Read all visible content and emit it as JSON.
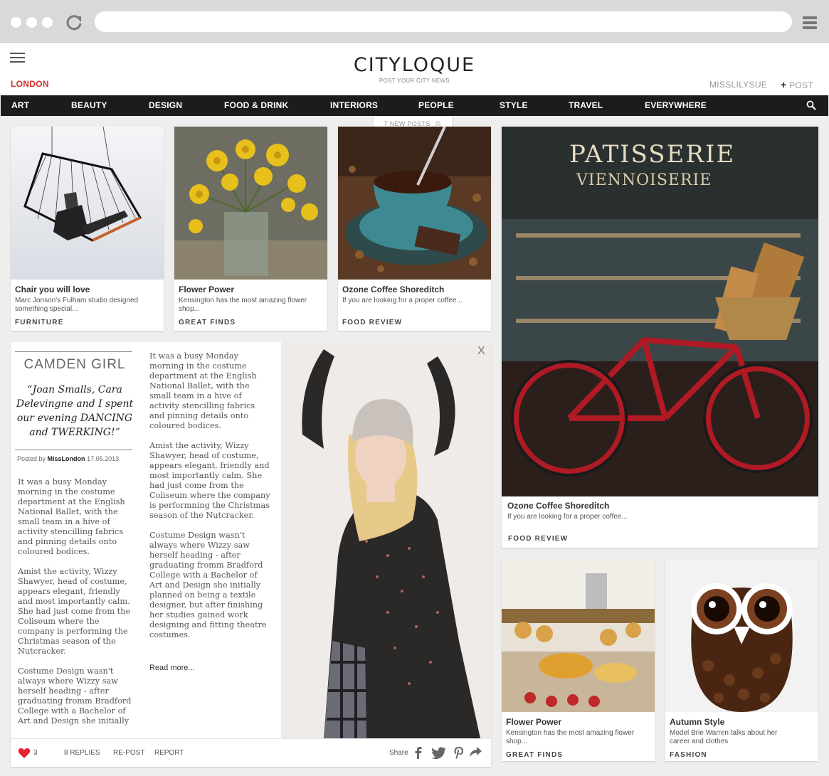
{
  "site": {
    "logo": "CITYLOQUE",
    "tagline": "POST YOUR CITY NEWS",
    "city": "LONDON",
    "user": "MISSLILYSUE",
    "post_label": "POST",
    "post_plus": "+"
  },
  "nav": {
    "items": [
      "ART",
      "BEAUTY",
      "DESIGN",
      "FOOD & DRINK",
      "INTERIORS",
      "PEOPLE",
      "STYLE",
      "TRAVEL",
      "EVERYWHERE"
    ],
    "new_posts": "7 NEW POSTS"
  },
  "cards": [
    {
      "title": "Chair you will love",
      "desc": "Marc Jonson's Fulham studio designed something special...",
      "category": "FURNITURE"
    },
    {
      "title": "Flower Power",
      "desc": "Kensington has the most amazing flower shop...",
      "category": "GREAT FINDS"
    },
    {
      "title": "Ozone Coffee Shoreditch",
      "desc": "If you are looking for a proper coffee...",
      "category": "FOOD REVIEW"
    },
    {
      "title": "Ozone Coffee Shoreditch",
      "desc": "If you are looking for a proper coffee...",
      "category": "FOOD REVIEW",
      "sign": "PATISSERIE",
      "sign2": "VIENNOISERIE"
    },
    {
      "title": "Flower Power",
      "desc": "Kensington has the most amazing flower shop...",
      "category": "GREAT FINDS"
    },
    {
      "title": "Autumn Style",
      "desc": "Model Brie Warren talks about her career and clothes",
      "category": "FASHION"
    }
  ],
  "article": {
    "title": "CAMDEN GIRL",
    "quote": "“Joan Smalls, Cara Delevingne and I spent our evening DANCING and TWERKING!”",
    "posted_by_label": "Posted by",
    "author": "MissLondon",
    "date": "17.05.2013",
    "col1": [
      "It was a busy Monday morning in the costume department at the English National Ballet, with the small team in a hive of activity stencilling fabrics and pinning details onto coloured bodices.",
      "Amist the activity, Wizzy Shawyer, head of costume, appears elegant, friendly and most importantly calm. She had just come from the Coliseum where the company is performing the Christmas season of the Nutcracker.",
      "Costume Design wasn't always where Wizzy saw herself heading - after graduating fromm Bradford College with a Bachelor of Art and Design she initially"
    ],
    "col2": [
      "It was a busy Monday morning in the costume department at the English National Ballet, with the small team in a hive of activity stencilling fabrics and pinning details onto coloured bodices.",
      "Amist the activity, Wizzy Shawyer, head of costume, appears elegant, friendly and most importantly calm. She had just come from the Coliseum where the company is performning the Christmas season of the Nutcracker.",
      "Costume Design wasn't always where Wizzy saw herself heading - after graduating fromm Bradford College with a Bachelor of Art and Design she initially planned on being a textile designer, but after finishing her studies gained work designing and fitting theatre costumes."
    ],
    "read_more": "Read more...",
    "close": "X",
    "likes": "3",
    "replies": "8 REPLIES",
    "repost": "RE-POST",
    "report": "REPORT",
    "share": "Share"
  },
  "colors": {
    "accent": "#d0312d",
    "nav_bg": "#1c1c1c",
    "heart": "#e8232f"
  },
  "icons": [
    "reload-icon",
    "browser-menu-icon",
    "hamburger-icon",
    "search-icon",
    "chevron-up-icon",
    "close-icon",
    "heart-icon",
    "facebook-icon",
    "twitter-icon",
    "pinterest-icon",
    "share-arrow-icon"
  ]
}
